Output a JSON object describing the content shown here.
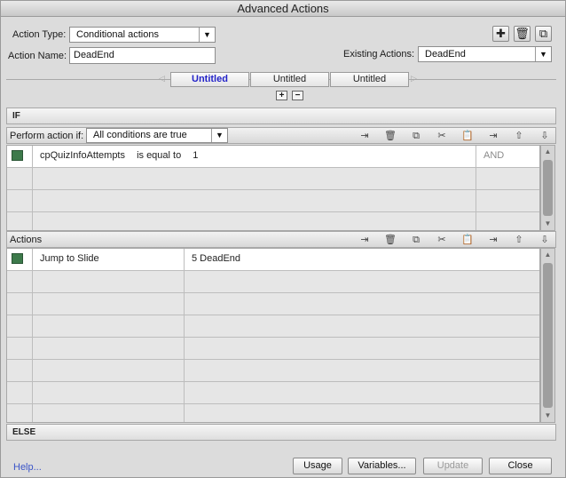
{
  "window": {
    "title": "Advanced Actions"
  },
  "header": {
    "action_type_label": "Action Type:",
    "action_type_value": "Conditional actions",
    "action_name_label": "Action Name:",
    "action_name_value": "DeadEnd",
    "existing_actions_label": "Existing Actions:",
    "existing_actions_value": "DeadEnd"
  },
  "tabs": [
    "Untitled",
    "Untitled",
    "Untitled"
  ],
  "if_section": {
    "label": "IF",
    "perform_label": "Perform action if:",
    "perform_value": "All conditions are true",
    "conditions": [
      {
        "variable": "cpQuizInfoAttempts",
        "operator": "is equal to",
        "value": "1",
        "connector": "AND"
      }
    ]
  },
  "actions_section": {
    "label": "Actions",
    "rows": [
      {
        "action": "Jump to Slide",
        "target": "5 DeadEnd"
      }
    ]
  },
  "else_section": {
    "label": "ELSE"
  },
  "footer": {
    "help_link": "Help...",
    "usage_button": "Usage",
    "variables_button": "Variables...",
    "update_button": "Update",
    "close_button": "Close"
  }
}
